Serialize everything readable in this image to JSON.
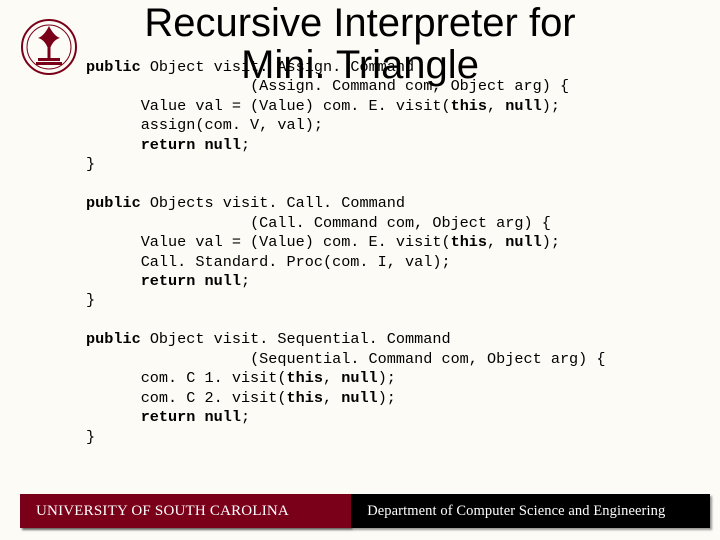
{
  "title_line1": "Recursive Interpreter for",
  "title_line2": "Mini. Triangle",
  "logo_alt": "university-seal",
  "code": {
    "m1": {
      "sig1_pre": "public",
      "sig1_type": "Object",
      "sig1_name": "visit. Assign. Command",
      "sig2_pre": "(Assign. Command com, Object arg) {",
      "body1_a": "Value val = (Value) com. E. visit(",
      "body1_b": "this",
      "body1_c": ", ",
      "body1_d": "null",
      "body1_e": ");",
      "body2": "assign(com. V, val);",
      "ret_a": "return null",
      "ret_b": ";",
      "close": "}"
    },
    "m2": {
      "sig1_pre": "public",
      "sig1_type": "Objects",
      "sig1_name": "visit. Call. Command",
      "sig2_pre": "(Call. Command com, Object arg) {",
      "body1_a": "Value val = (Value) com. E. visit(",
      "body1_b": "this",
      "body1_c": ", ",
      "body1_d": "null",
      "body1_e": ");",
      "body2": "Call. Standard. Proc(com. I, val);",
      "ret_a": "return null",
      "ret_b": ";",
      "close": "}"
    },
    "m3": {
      "sig1_pre": "public",
      "sig1_type": "Object",
      "sig1_name": "visit. Sequential. Command",
      "sig2_pre": "(Sequential. Command com, Object arg) {",
      "body1_a": "com. C 1. visit(",
      "body1_b": "this",
      "body1_c": ", ",
      "body1_d": "null",
      "body1_e": ");",
      "body2_a": "com. C 2. visit(",
      "body2_b": "this",
      "body2_c": ", ",
      "body2_d": "null",
      "body2_e": ");",
      "ret_a": "return null",
      "ret_b": ";",
      "close": "}"
    }
  },
  "footer": {
    "left": "UNIVERSITY OF SOUTH CAROLINA",
    "right": "Department of Computer Science and Engineering"
  },
  "colors": {
    "garnet": "#7a0019",
    "black": "#000000",
    "paper": "#fdfbf6"
  }
}
